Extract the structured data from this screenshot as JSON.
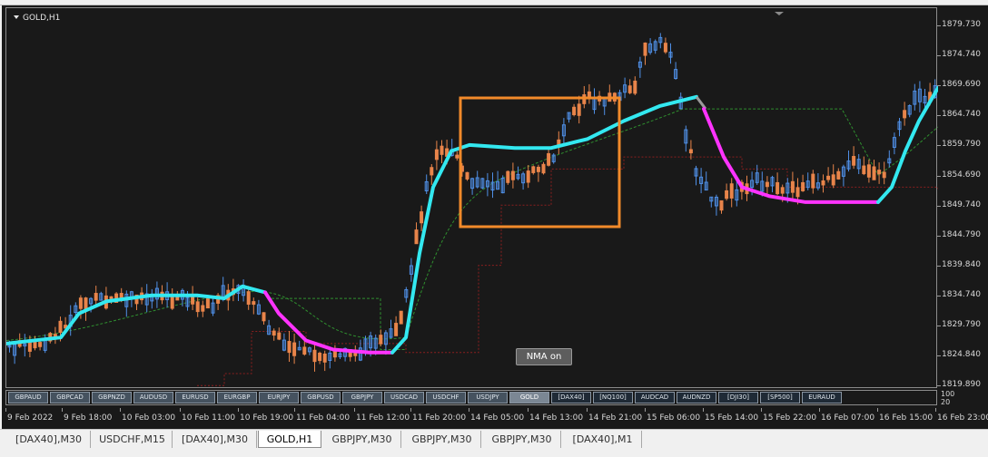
{
  "window": {
    "symbol_label": "GOLD,H1"
  },
  "nma_button": {
    "label": "NMA on"
  },
  "price_axis": {
    "labels": [
      "1879.730",
      "1874.740",
      "1869.690",
      "1864.740",
      "1859.790",
      "1854.690",
      "1849.740",
      "1844.790",
      "1839.840",
      "1834.740",
      "1829.790",
      "1824.840",
      "1819.890"
    ]
  },
  "volume_axis": {
    "labels": [
      "100",
      "20"
    ]
  },
  "time_axis": {
    "labels": [
      "9 Feb 2022",
      "9 Feb 18:00",
      "10 Feb 03:00",
      "10 Feb 11:00",
      "10 Feb 19:00",
      "11 Feb 04:00",
      "11 Feb 12:00",
      "11 Feb 20:00",
      "14 Feb 05:00",
      "14 Feb 13:00",
      "14 Feb 21:00",
      "15 Feb 06:00",
      "15 Feb 14:00",
      "15 Feb 22:00",
      "16 Feb 07:00",
      "16 Feb 15:00",
      "16 Feb 23:00"
    ]
  },
  "symbol_buttons": [
    {
      "label": "GBPAUD",
      "active": false
    },
    {
      "label": "GBPCAD",
      "active": false
    },
    {
      "label": "GBPNZD",
      "active": false
    },
    {
      "label": "AUDUSD",
      "active": false
    },
    {
      "label": "EURUSD",
      "active": false
    },
    {
      "label": "EURGBP",
      "active": false
    },
    {
      "label": "EURJPY",
      "active": false
    },
    {
      "label": "GBPUSD",
      "active": false
    },
    {
      "label": "GBPJPY",
      "active": false
    },
    {
      "label": "USDCAD",
      "active": false
    },
    {
      "label": "USDCHF",
      "active": false
    },
    {
      "label": "USDJPY",
      "active": false
    },
    {
      "label": "GOLD",
      "active": true
    },
    {
      "label": "[DAX40]",
      "active": false
    },
    {
      "label": "[NQ100]",
      "active": false
    },
    {
      "label": "AUDCAD",
      "active": false
    },
    {
      "label": "AUDNZD",
      "active": false
    },
    {
      "label": "[DJI30]",
      "active": false
    },
    {
      "label": "[SP500]",
      "active": false
    },
    {
      "label": "EURAUD",
      "active": false
    }
  ],
  "tabs": [
    {
      "label": "[DAX40],M30",
      "active": false
    },
    {
      "label": "USDCHF,M15",
      "active": false
    },
    {
      "label": "[DAX40],M30",
      "active": false
    },
    {
      "label": "GOLD,H1",
      "active": true
    },
    {
      "label": "GBPJPY,M30",
      "active": false
    },
    {
      "label": "GBPJPY,M30",
      "active": false
    },
    {
      "label": "GBPJPY,M30",
      "active": false
    },
    {
      "label": "[DAX40],M1",
      "active": false
    }
  ],
  "colors": {
    "background": "#191919",
    "bull": "#4f8fe6",
    "bear": "#e8844a",
    "nma_up": "#33e8f0",
    "nma_down": "#ff33ff",
    "highlight_box": "#f28a2a",
    "signal_green": "#2f8f2f",
    "signal_red": "#8b1f1f"
  }
}
